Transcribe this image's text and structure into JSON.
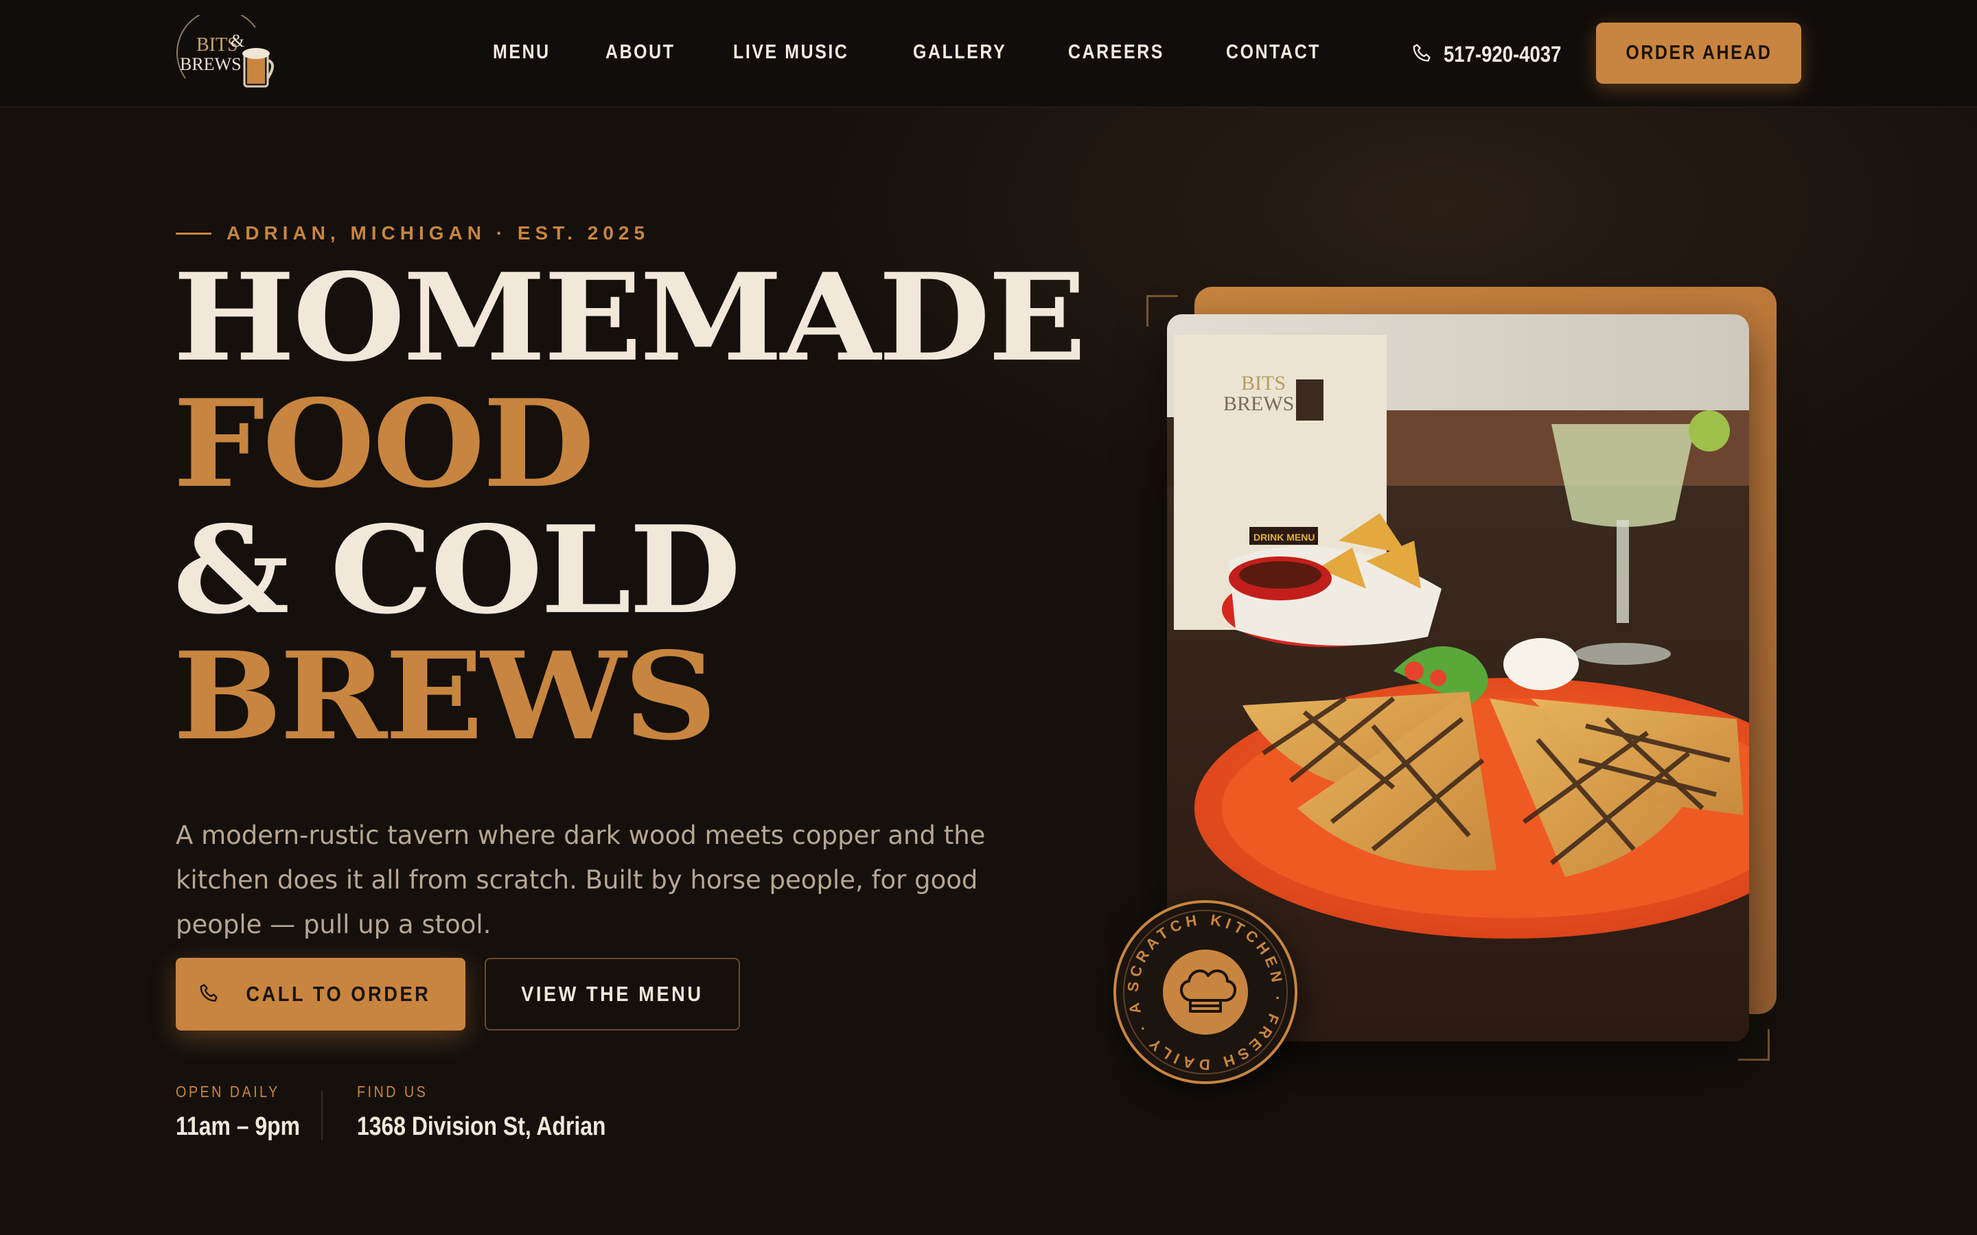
{
  "brand": {
    "logo_text_top": "BITS",
    "logo_text_amp": "&",
    "logo_text_bottom": "BREWS"
  },
  "nav": {
    "items": [
      {
        "label": "MENU"
      },
      {
        "label": "ABOUT"
      },
      {
        "label": "LIVE MUSIC"
      },
      {
        "label": "GALLERY"
      },
      {
        "label": "CAREERS"
      },
      {
        "label": "CONTACT"
      }
    ],
    "phone": "517-920-4037",
    "phone_icon": "phone-icon",
    "order_label": "ORDER AHEAD"
  },
  "hero": {
    "eyebrow": "ADRIAN, MICHIGAN · EST. 2025",
    "headline": {
      "line1": "HOMEMADE",
      "line2": "FOOD",
      "line3": "& COLD",
      "line4": "BREWS"
    },
    "lede": "A modern-rustic tavern where dark wood meets copper and the kitchen does it all from scratch. Built by horse people, for good people — pull up a stool.",
    "cta_primary": "CALL TO ORDER",
    "cta_primary_icon": "phone-icon",
    "cta_secondary": "VIEW THE MENU",
    "hours_label": "OPEN DAILY",
    "hours_value": "11am – 9pm",
    "location_label": "FIND US",
    "location_value": "1368 Division St, Adrian"
  },
  "photo": {
    "menu_card_label": "DRINK MENU",
    "badge_ring_text": "SCRATCH KITCHEN · FRESH DAILY · ADRIAN ·",
    "badge_icon": "chef-hat-icon"
  },
  "colors": {
    "background": "#15100c",
    "nav_background": "#110d0a",
    "accent_copper": "#c8853f",
    "cream_text": "#f1e8da",
    "muted_text": "#b7a792"
  }
}
